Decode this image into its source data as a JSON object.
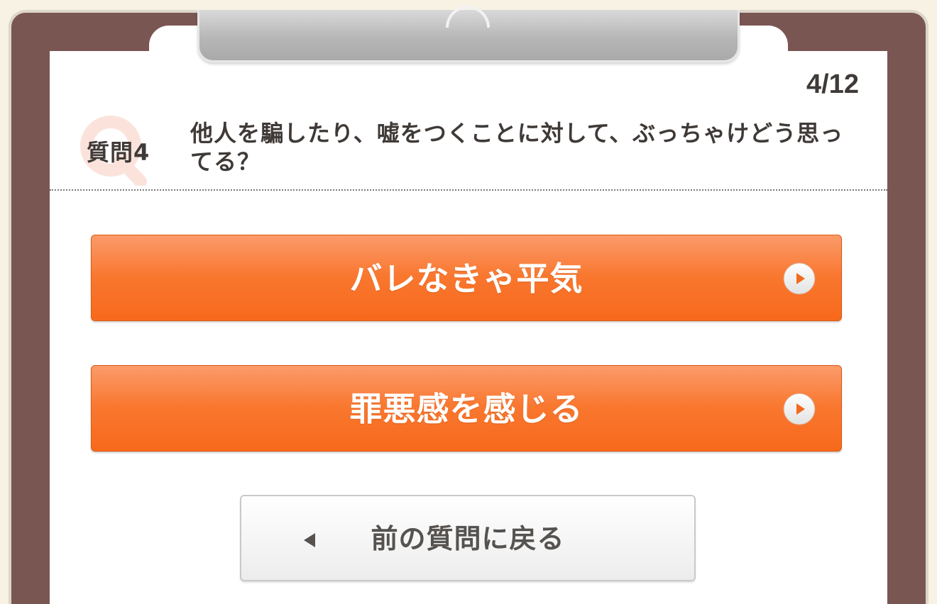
{
  "progress": {
    "text": "4/12"
  },
  "question": {
    "number_label": "質問4",
    "text": "他人を騙したり、嘘をつくことに対して、ぶっちゃけどう思ってる？"
  },
  "answers": [
    {
      "label": "バレなきゃ平気"
    },
    {
      "label": "罪悪感を感じる"
    }
  ],
  "back_button": {
    "label": "前の質問に戻る"
  },
  "colors": {
    "board": "#7a5653",
    "paper": "#ffffff",
    "answer_top": "#fb9b6b",
    "answer_bottom": "#f7691b",
    "text_dark": "#3f3a37",
    "q_mark": "#fbe3dc"
  },
  "icons": {
    "q_mark": "q-letter-icon",
    "answer_arrow": "play-circle-icon",
    "back_arrow": "triangle-left-icon"
  }
}
